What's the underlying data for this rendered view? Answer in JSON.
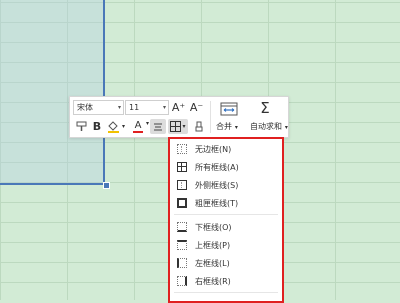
{
  "toolbar": {
    "font_name": "宋体",
    "font_size": "11",
    "grow_font_glyph": "A⁺",
    "shrink_font_glyph": "A⁻",
    "bold_glyph": "B",
    "font_color_glyph": "A",
    "merge_label": "合并",
    "autosum_label": "自动求和",
    "sum_glyph": "Σ",
    "dropdown_glyph": "▾"
  },
  "border_menu": {
    "items": [
      {
        "label": "无边框(N)",
        "icon": "no-border-icon"
      },
      {
        "label": "所有框线(A)",
        "icon": "all-borders-icon"
      },
      {
        "label": "外侧框线(S)",
        "icon": "outside-borders-icon"
      },
      {
        "label": "粗匣框线(T)",
        "icon": "thick-box-border-icon"
      },
      {
        "label": "下框线(O)",
        "icon": "bottom-border-icon"
      },
      {
        "label": "上框线(P)",
        "icon": "top-border-icon"
      },
      {
        "label": "左框线(L)",
        "icon": "left-border-icon"
      },
      {
        "label": "右框线(R)",
        "icon": "right-border-icon"
      }
    ]
  },
  "colors": {
    "sheet_background": "#d2ebd5",
    "selection_border": "#4a78b8",
    "menu_highlight_border": "#e02020",
    "font_color_bar": "#e02020",
    "fill_color_bar": "#f2c200"
  }
}
